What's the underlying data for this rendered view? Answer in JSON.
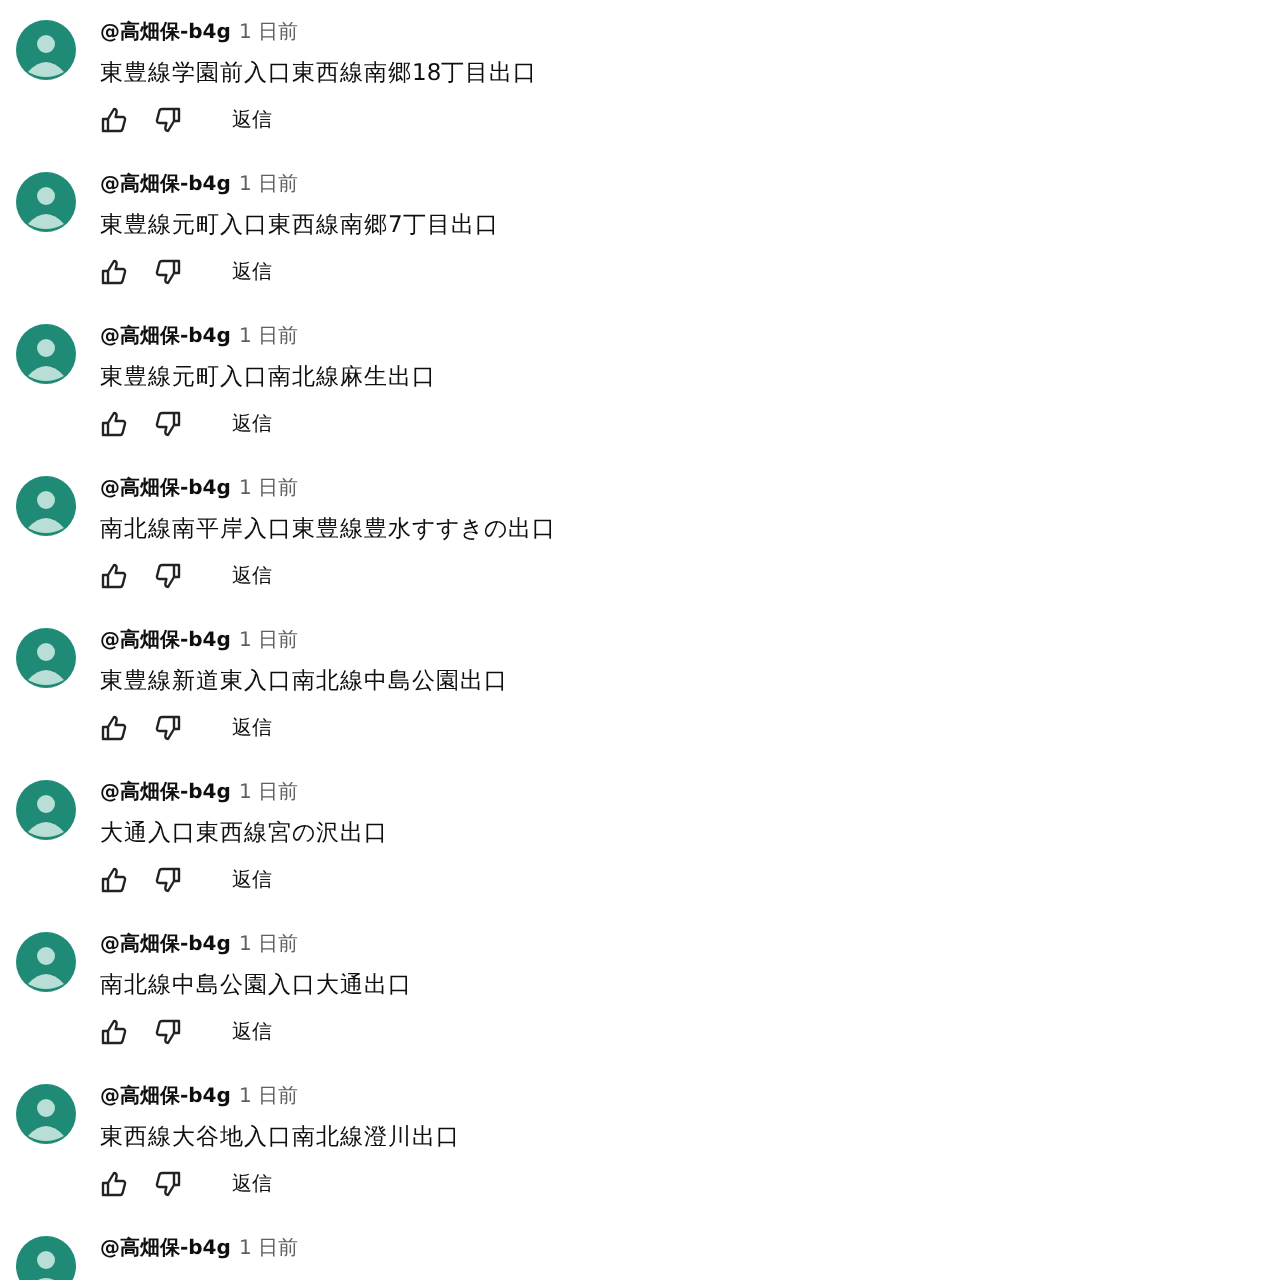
{
  "comments": [
    {
      "author": "@高畑保-b4g",
      "time": "1 日前",
      "text": "東豊線学園前入口東西線南郷18丁目出口",
      "reply": "返信"
    },
    {
      "author": "@高畑保-b4g",
      "time": "1 日前",
      "text": "東豊線元町入口東西線南郷7丁目出口",
      "reply": "返信"
    },
    {
      "author": "@高畑保-b4g",
      "time": "1 日前",
      "text": "東豊線元町入口南北線麻生出口",
      "reply": "返信"
    },
    {
      "author": "@高畑保-b4g",
      "time": "1 日前",
      "text": "南北線南平岸入口東豊線豊水すすきの出口",
      "reply": "返信"
    },
    {
      "author": "@高畑保-b4g",
      "time": "1 日前",
      "text": "東豊線新道東入口南北線中島公園出口",
      "reply": "返信"
    },
    {
      "author": "@高畑保-b4g",
      "time": "1 日前",
      "text": "大通入口東西線宮の沢出口",
      "reply": "返信"
    },
    {
      "author": "@高畑保-b4g",
      "time": "1 日前",
      "text": "南北線中島公園入口大通出口",
      "reply": "返信"
    },
    {
      "author": "@高畑保-b4g",
      "time": "1 日前",
      "text": "東西線大谷地入口南北線澄川出口",
      "reply": "返信"
    },
    {
      "author": "@高畑保-b4g",
      "time": "1 日前"
    }
  ]
}
